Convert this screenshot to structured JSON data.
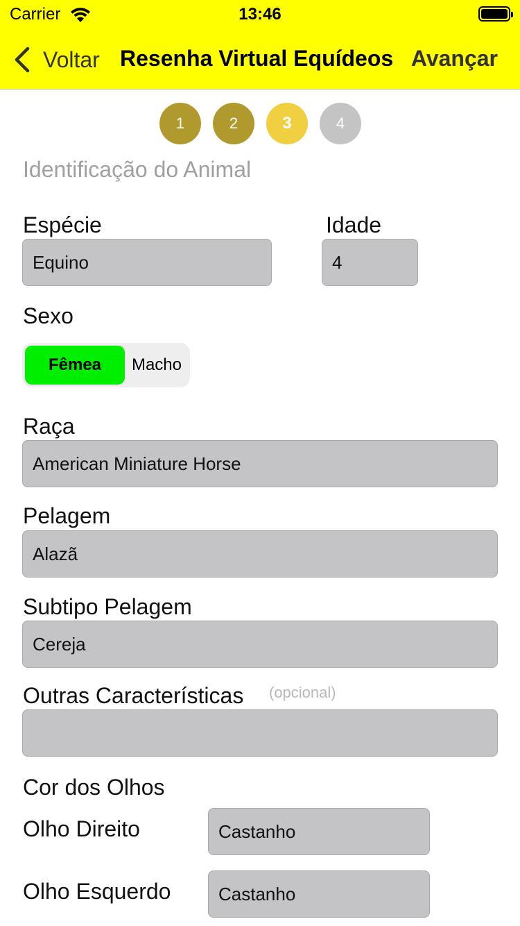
{
  "status": {
    "carrier": "Carrier",
    "time": "13:46"
  },
  "nav": {
    "back_label": "Voltar",
    "title": "Resenha Virtual Equídeos",
    "next_label": "Avançar",
    "bar_color": "#ffff00"
  },
  "steps": [
    "1",
    "2",
    "3",
    "4"
  ],
  "steps_current": 3,
  "section_title": "Identificação do Animal",
  "especie": {
    "label": "Espécie",
    "value": "Equino"
  },
  "idade": {
    "label": "Idade",
    "value": "4"
  },
  "sexo": {
    "label": "Sexo",
    "options": [
      "Fêmea",
      "Macho"
    ],
    "selected": "Fêmea",
    "selected_color": "#00ee00"
  },
  "raca": {
    "label": "Raça",
    "value": "American Miniature Horse"
  },
  "pelagem": {
    "label": "Pelagem",
    "value": "Alazã"
  },
  "subtipo": {
    "label": "Subtipo Pelagem",
    "value": "Cereja"
  },
  "outras": {
    "label": "Outras Características",
    "optional": "(opcional)",
    "value": ""
  },
  "olhos": {
    "title": "Cor dos Olhos",
    "direito": {
      "label": "Olho Direito",
      "value": "Castanho"
    },
    "esquerdo": {
      "label": "Olho Esquerdo",
      "value": "Castanho"
    }
  }
}
